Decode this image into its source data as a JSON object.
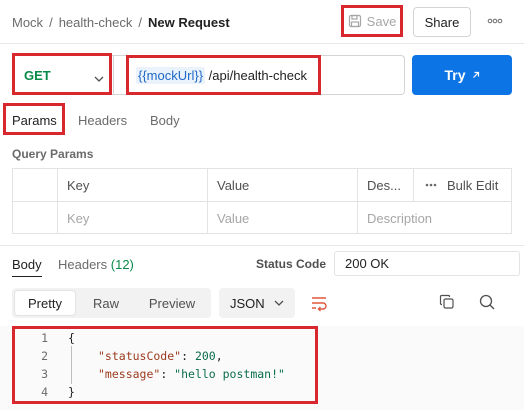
{
  "breadcrumb": {
    "collection": "Mock",
    "sep1": "/",
    "folder": "health-check",
    "sep2": "/",
    "request": "New Request"
  },
  "header_actions": {
    "save_label": "Save",
    "share_label": "Share",
    "more_icon": "more-horizontal-icon"
  },
  "request": {
    "method": "GET",
    "url_variable": "{{mockUrl}}",
    "url_path": " /api/health-check",
    "send_label": "Try",
    "send_icon": "arrow-up-right-icon"
  },
  "request_tabs": [
    "Params",
    "Headers",
    "Body"
  ],
  "query_params": {
    "title": "Query Params",
    "columns": [
      "Key",
      "Value",
      "Des...",
      "Bulk Edit"
    ],
    "placeholders": [
      "Key",
      "Value",
      "Description"
    ]
  },
  "response": {
    "tabs": {
      "body": "Body",
      "headers": "Headers",
      "headers_count": "(12)"
    },
    "status_label": "Status Code",
    "status_value": "200 OK",
    "view_modes": [
      "Pretty",
      "Raw",
      "Preview"
    ],
    "format": "JSON",
    "code_lines": [
      {
        "n": "1",
        "text": "{"
      },
      {
        "n": "2",
        "key": "\"statusCode\"",
        "sep": ": ",
        "value": "200",
        "end": ","
      },
      {
        "n": "3",
        "key": "\"message\"",
        "sep": ": ",
        "value": "\"hello postman!\"",
        "end": ""
      },
      {
        "n": "4",
        "text": "}"
      }
    ]
  },
  "colors": {
    "accent": "#0c74e4",
    "method_get": "#0a8a4a",
    "highlight": "#d9272e",
    "variable_bg": "#eaf2fc"
  }
}
